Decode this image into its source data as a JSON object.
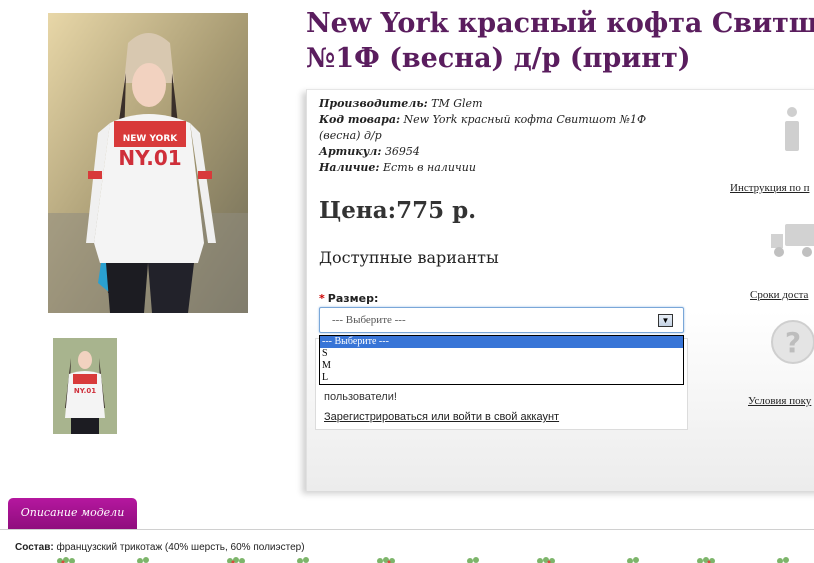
{
  "product": {
    "title_line1": "New York красный кофта Свитшот",
    "title_line2": "№1Ф (весна) д/р (принт)"
  },
  "meta": {
    "manufacturer_label": "Производитель:",
    "manufacturer_value": "ТМ Glem",
    "code_label": "Код товара:",
    "code_value_line1": "New York красный кофта Свитшот №1Ф",
    "code_value_line2": "(весна) д/р",
    "article_label": "Артикул:",
    "article_value": "36954",
    "availability_label": "Наличие:",
    "availability_value": "Есть в наличии"
  },
  "price": "Цена:775 р.",
  "variants_heading": "Доступные варианты",
  "size": {
    "required_mark": "*",
    "label": "Размер:",
    "selected": "--- Выберите ---",
    "options": [
      "--- Выберите ---",
      "S",
      "M",
      "L"
    ]
  },
  "login": {
    "message": "пользователи!",
    "link": "Зарегистрироваться или войти в свой аккаунт"
  },
  "side": {
    "instruction": "Инструкция по п",
    "delivery": "Сроки доста",
    "conditions": "Условия поку"
  },
  "tabs": {
    "description": "Описание модели"
  },
  "composition": {
    "label": "Состав:",
    "value": "французский трикотаж (40% шерсть, 60% полиэстер)"
  },
  "colors": {
    "title": "#5a1d5e",
    "tab": "#a3138e",
    "select_highlight": "#3875d7"
  }
}
